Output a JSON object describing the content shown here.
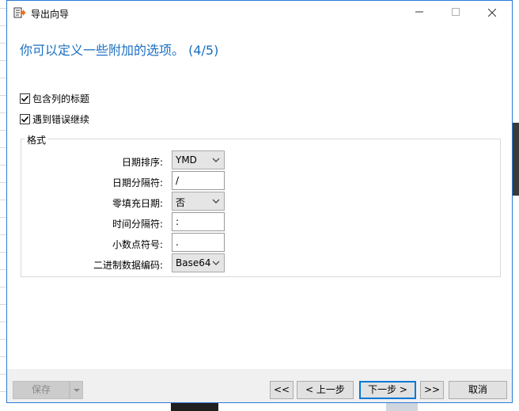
{
  "window": {
    "title": "导出向导"
  },
  "heading": "你可以定义一些附加的选项。 (4/5)",
  "checkboxes": [
    {
      "label": "包含列的标题",
      "checked": true
    },
    {
      "label": "遇到错误继续",
      "checked": true
    }
  ],
  "format": {
    "group_label": "格式",
    "date_order": {
      "label": "日期排序:",
      "value": "YMD"
    },
    "date_separator": {
      "label": "日期分隔符:",
      "value": "/"
    },
    "zero_pad_date": {
      "label": "零填充日期:",
      "value": "否"
    },
    "time_separator": {
      "label": "时间分隔符:",
      "value": ":"
    },
    "decimal_symbol": {
      "label": "小数点符号:",
      "value": "."
    },
    "binary_encoding": {
      "label": "二进制数据编码:",
      "value": "Base64"
    }
  },
  "footer": {
    "save": "保存",
    "first": "<<",
    "prev": "< 上一步",
    "next": "下一步 >",
    "last": ">>",
    "cancel": "取消"
  },
  "colors": {
    "accent": "#1a6fc2",
    "border": "#2b7bd6"
  }
}
